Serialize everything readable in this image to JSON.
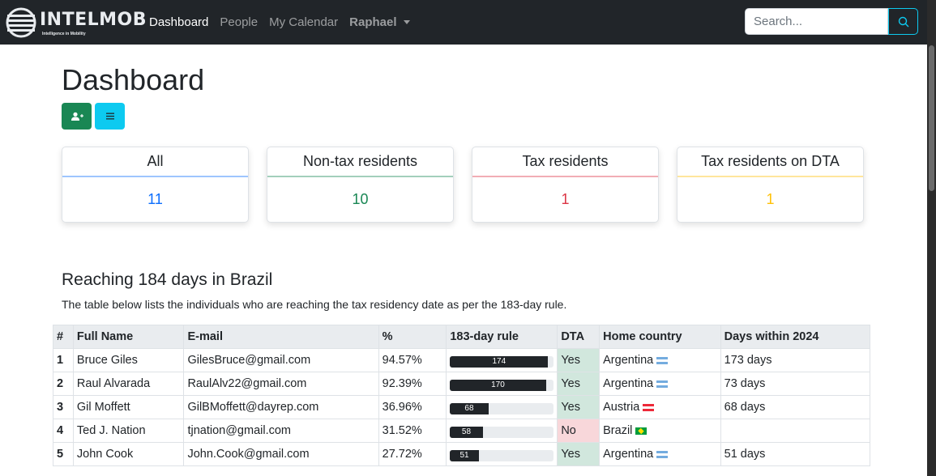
{
  "navbar": {
    "brand": "INTELMOB",
    "tagline": "Intelligence in Mobility",
    "links": [
      {
        "label": "Dashboard",
        "active": true
      },
      {
        "label": "People",
        "active": false
      },
      {
        "label": "My Calendar",
        "active": false
      }
    ],
    "user": "Raphael",
    "search_placeholder": "Search..."
  },
  "page": {
    "title": "Dashboard",
    "buttons": [
      {
        "icon": "add-user-icon",
        "color": "#198754"
      },
      {
        "icon": "list-icon",
        "color": "#0dcaf0"
      }
    ]
  },
  "cards": [
    {
      "title": "All",
      "value": "11",
      "color": "#0d6efd",
      "border": "#9ec5fe"
    },
    {
      "title": "Non-tax residents",
      "value": "10",
      "color": "#198754",
      "border": "#a3cfbb"
    },
    {
      "title": "Tax residents",
      "value": "1",
      "color": "#dc3545",
      "border": "#f1aeb5"
    },
    {
      "title": "Tax residents on DTA",
      "value": "1",
      "color": "#ffc107",
      "border": "#ffe69c"
    }
  ],
  "section": {
    "title": "Reaching 184 days in Brazil",
    "description": "The table below lists the individuals who are reaching the tax residency date as per the 183-day rule."
  },
  "table": {
    "headers": [
      "#",
      "Full Name",
      "E-mail",
      "%",
      "183-day rule",
      "DTA",
      "Home country",
      "Days within 2024"
    ],
    "rows": [
      {
        "n": "1",
        "name": "Bruce Giles",
        "email": "GilesBruce@gmail.com",
        "pct": "94.57%",
        "rule": "174",
        "rule_fraction": 0.9457,
        "dta": "Yes",
        "country": "Argentina",
        "flag": "ar",
        "days": "173 days"
      },
      {
        "n": "2",
        "name": "Raul Alvarada",
        "email": "RaulAlv22@gmail.com",
        "pct": "92.39%",
        "rule": "170",
        "rule_fraction": 0.9239,
        "dta": "Yes",
        "country": "Argentina",
        "flag": "ar",
        "days": "73 days"
      },
      {
        "n": "3",
        "name": "Gil Moffett",
        "email": "GilBMoffett@dayrep.com",
        "pct": "36.96%",
        "rule": "68",
        "rule_fraction": 0.3696,
        "dta": "Yes",
        "country": "Austria",
        "flag": "at",
        "days": "68 days"
      },
      {
        "n": "4",
        "name": "Ted J. Nation",
        "email": "tjnation@gmail.com",
        "pct": "31.52%",
        "rule": "58",
        "rule_fraction": 0.3152,
        "dta": "No",
        "country": "Brazil",
        "flag": "br",
        "days": ""
      },
      {
        "n": "5",
        "name": "John Cook",
        "email": "John.Cook@gmail.com",
        "pct": "27.72%",
        "rule": "51",
        "rule_fraction": 0.2772,
        "dta": "Yes",
        "country": "Argentina",
        "flag": "ar",
        "days": "51 days"
      }
    ]
  }
}
